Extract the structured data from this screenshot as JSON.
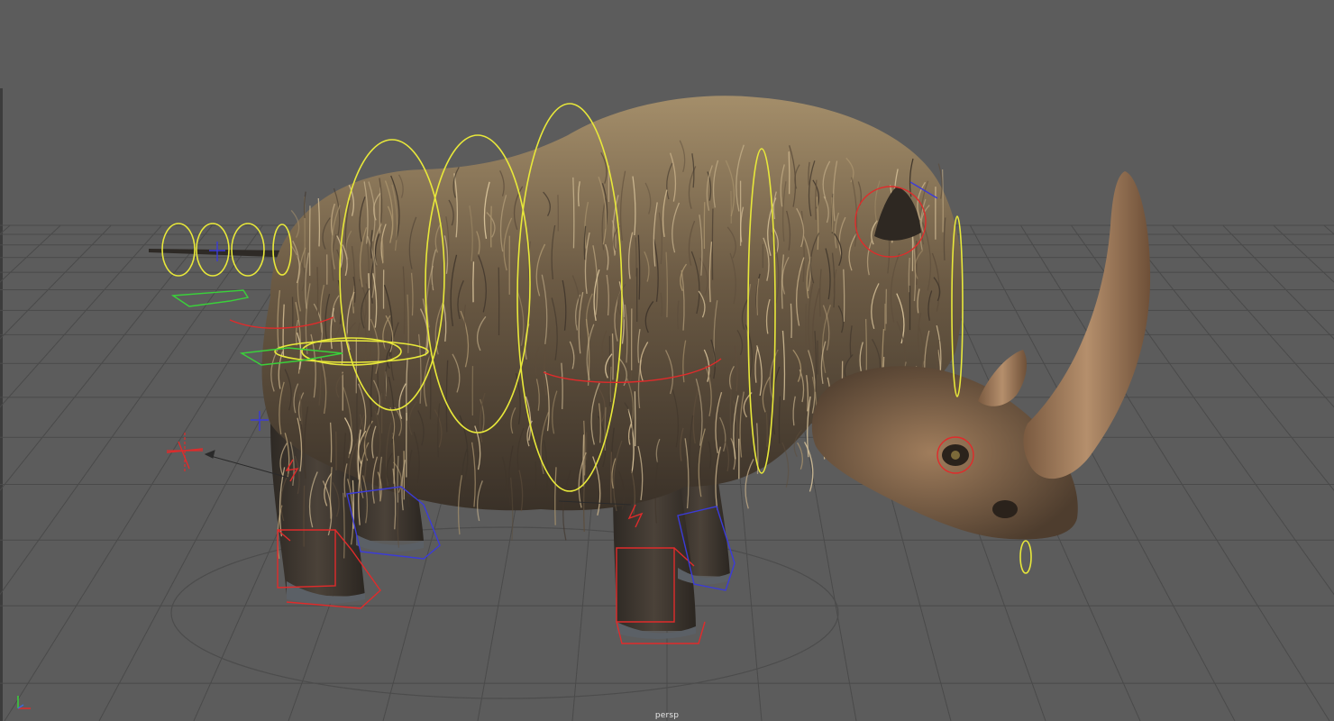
{
  "viewport": {
    "camera_label": "persp",
    "background_color": "#5c5c5c",
    "grid_color": "#4a4a4a"
  },
  "model": {
    "subject": "woolly-rhinoceros",
    "fur_color": "#8a7558",
    "skin_color": "#4a3f33",
    "horn_color": "#9a7a5c"
  },
  "rig_controls": {
    "fk_controls_color": "#e8e83a",
    "ik_controls_color": "#e02b2b",
    "selection_color": "#3b3bd8",
    "pole_vector_color": "#3ad13a"
  },
  "icons": {
    "axis_gizmo": "xyz-axis-icon"
  }
}
